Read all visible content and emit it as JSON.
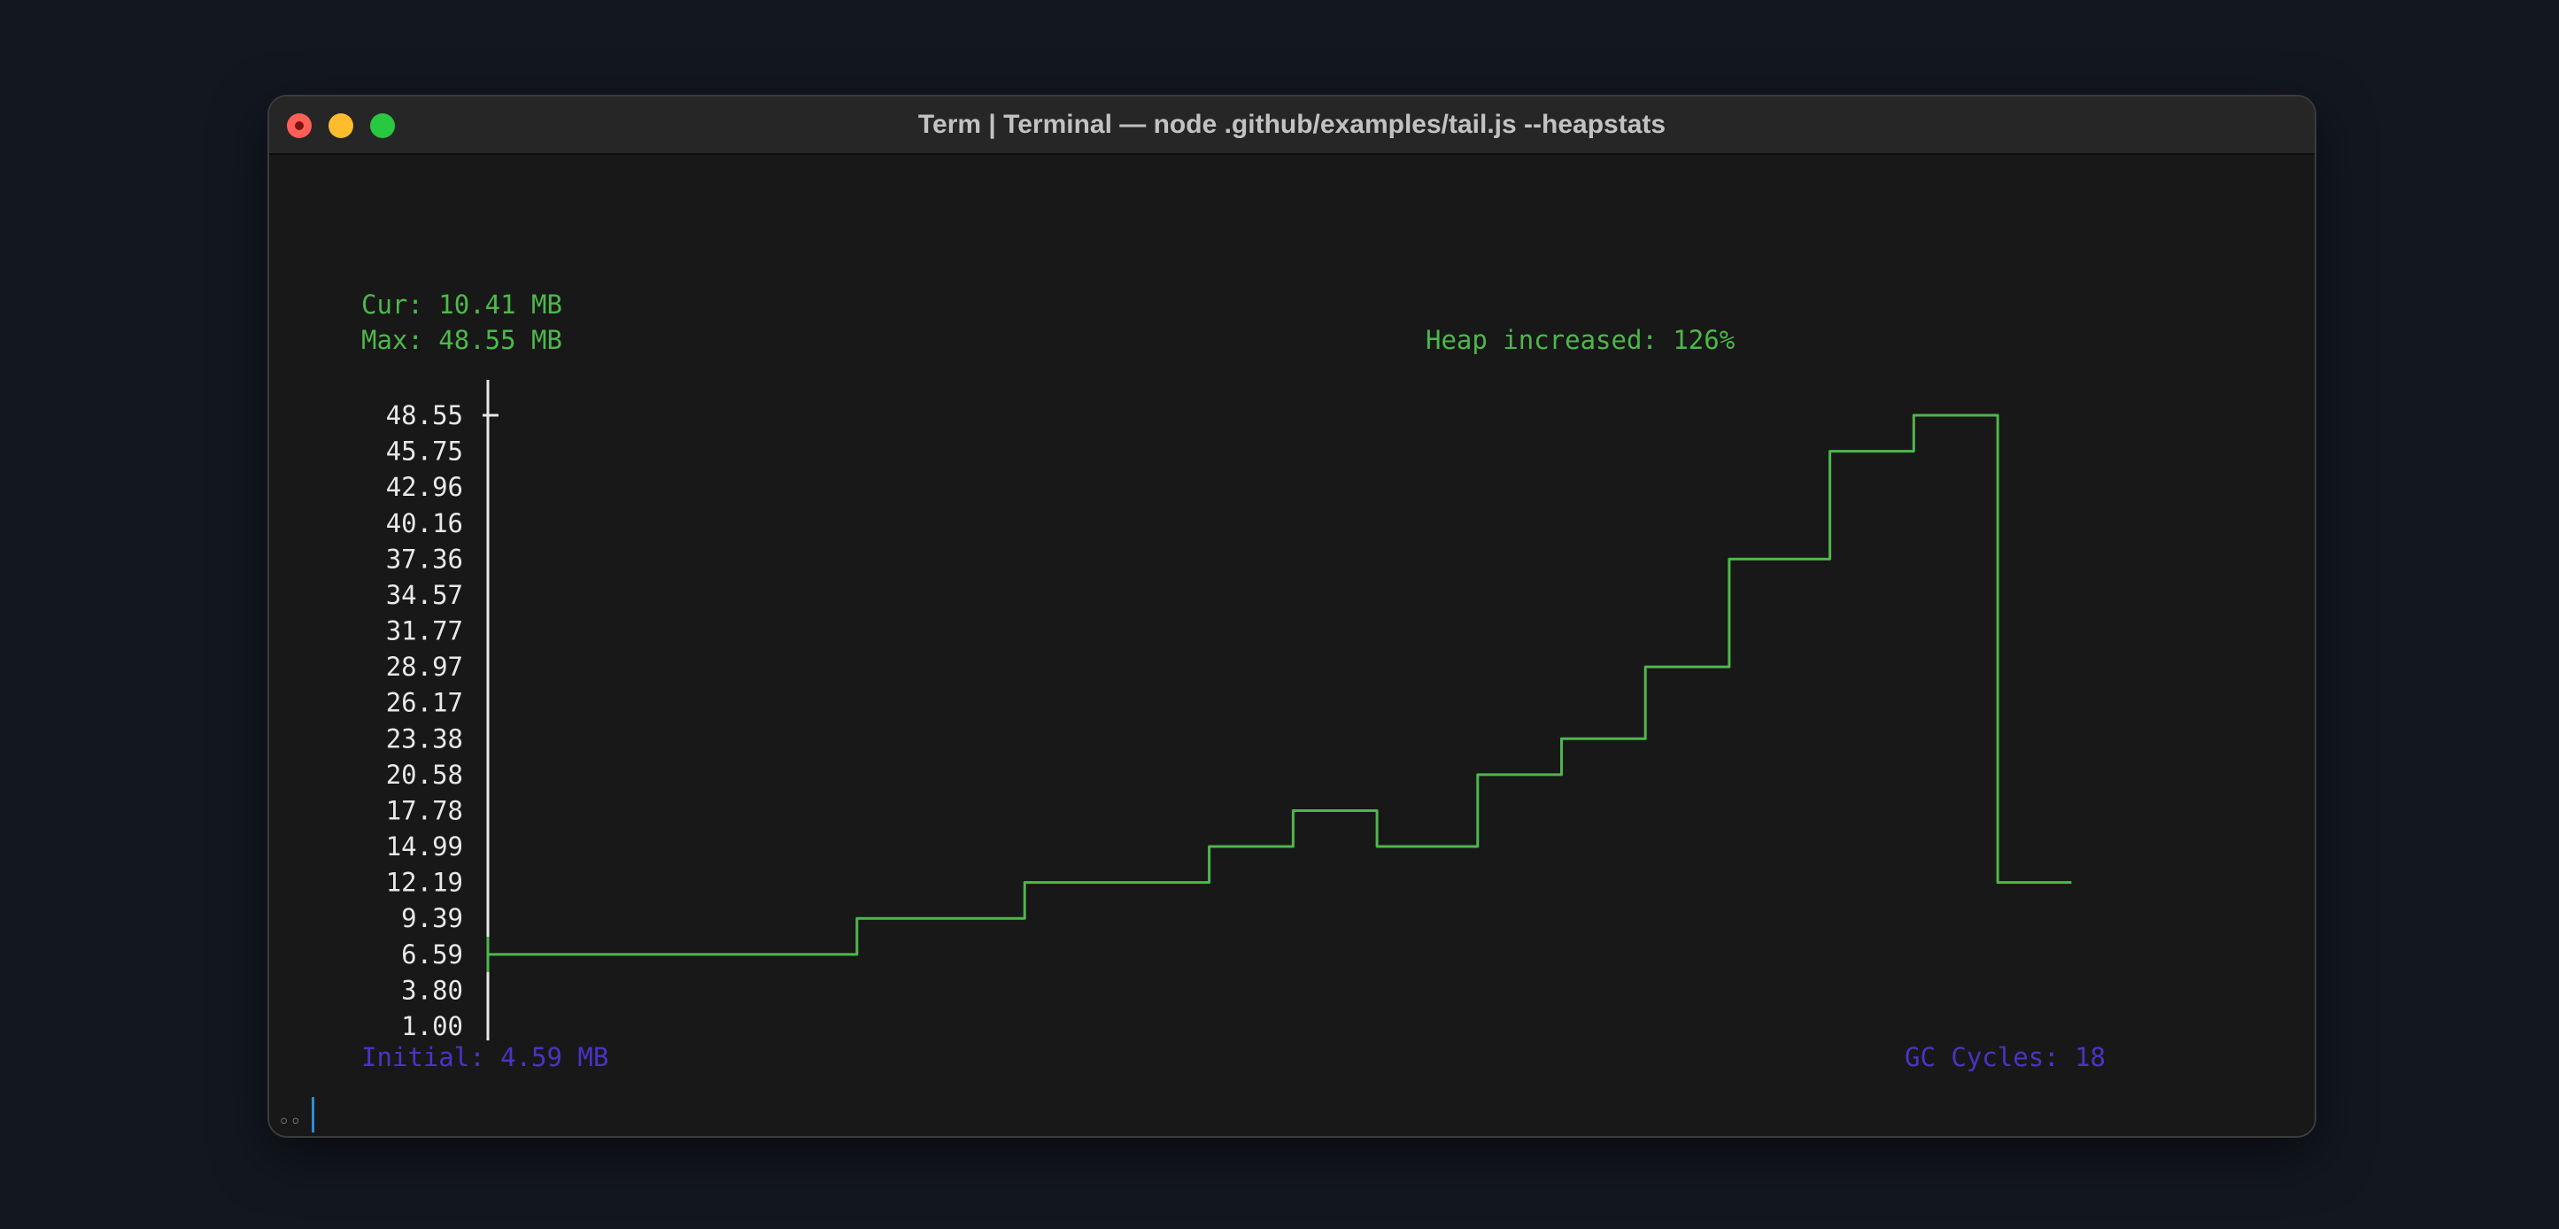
{
  "window": {
    "title": "Term | Terminal — node .github/examples/tail.js --heapstats"
  },
  "stats": {
    "cur": "Cur: 10.41 MB",
    "max": "Max: 48.55 MB",
    "heap_increased": "Heap increased: 126%",
    "initial": "Initial: 4.59 MB",
    "gc_cycles": "GC Cycles: 18"
  },
  "colors": {
    "line": "#4db84a",
    "stats_green": "#4db84a",
    "stats_purple": "#4b33c4",
    "axis": "#e8e8e8"
  },
  "prompt": {
    "text": "◦◦"
  },
  "chart_data": {
    "type": "line",
    "step": true,
    "yticks": [
      "48.55",
      "45.75",
      "42.96",
      "40.16",
      "37.36",
      "34.57",
      "31.77",
      "28.97",
      "26.17",
      "23.38",
      "20.58",
      "17.78",
      "14.99",
      "12.19",
      "9.39",
      "6.59",
      "3.80",
      "1.00"
    ],
    "ylim": [
      1.0,
      48.55
    ],
    "x_tick_count": 25,
    "x_range": [
      0,
      23.7
    ],
    "series": [
      {
        "points": [
          [
            0,
            6.59
          ],
          [
            5.5,
            6.59
          ],
          [
            5.5,
            9.39
          ],
          [
            8.0,
            9.39
          ],
          [
            8.0,
            12.19
          ],
          [
            10.75,
            12.19
          ],
          [
            10.75,
            14.99
          ],
          [
            12.0,
            14.99
          ],
          [
            12.0,
            17.78
          ],
          [
            13.25,
            17.78
          ],
          [
            13.25,
            14.99
          ],
          [
            14.75,
            14.99
          ],
          [
            14.75,
            20.58
          ],
          [
            16.0,
            20.58
          ],
          [
            16.0,
            23.38
          ],
          [
            17.25,
            23.38
          ],
          [
            17.25,
            28.97
          ],
          [
            18.5,
            28.97
          ],
          [
            18.5,
            37.36
          ],
          [
            20.0,
            37.36
          ],
          [
            20.0,
            45.75
          ],
          [
            21.25,
            45.75
          ],
          [
            21.25,
            48.55
          ],
          [
            22.5,
            48.55
          ],
          [
            22.5,
            12.19
          ],
          [
            23.6,
            12.19
          ]
        ]
      }
    ]
  }
}
